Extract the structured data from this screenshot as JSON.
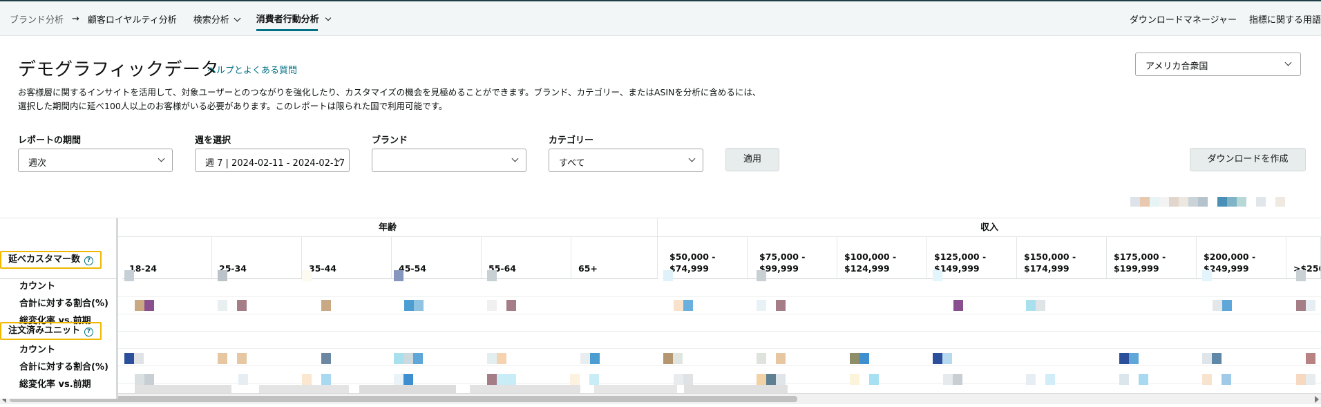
{
  "nav": {
    "crumb1": "ブランド分析",
    "crumb2": "顧客ロイヤルティ分析",
    "crumb3": "検索分析",
    "crumb4": "消費者行動分析",
    "download_manager": "ダウンロードマネージャー",
    "metrics_glossary": "指標に関する用語"
  },
  "header": {
    "title": "デモグラフィックデータ",
    "help_link": "ヘルプとよくある質問",
    "desc1": "お客様層に関するインサイトを活用して、対象ユーザーとのつながりを強化したり、カスタマイズの機会を見極めることができます。ブランド、カテゴリー、またはASINを分析に含めるには、",
    "desc2": "選択した期間内に延べ100人以上のお客様がいる必要があります。このレポートは限られた国で利用可能です。",
    "country": "アメリカ合衆国"
  },
  "filters": {
    "period_label": "レポートの期間",
    "period_value": "週次",
    "week_label": "週を選択",
    "week_value": "週 7 | 2024-02-11 - 2024-02-17",
    "brand_label": "ブランド",
    "brand_value": "",
    "category_label": "カテゴリー",
    "category_value": "すべて",
    "apply": "適用",
    "create_download": "ダウンロードを作成"
  },
  "table": {
    "group_age": "年齢",
    "group_income": "収入",
    "age_cols": [
      "18-24",
      "25-34",
      "35-44",
      "45-54",
      "55-64",
      "65+"
    ],
    "income_cols": [
      "$50,000 - $74,999",
      "$75,000 - $99,999",
      "$100,000 - $124,999",
      "$125,000 - $149,999",
      "$150,000 - $174,999",
      "$175,000 - $199,999",
      "$200,000 - $249,999",
      ">$250"
    ],
    "section1": "延べカスタマー数",
    "section2": "注文済みユニット",
    "row_count": "カウント",
    "row_share": "合計に対する割合(%)",
    "row_change": "総変化率 vs.前期"
  }
}
